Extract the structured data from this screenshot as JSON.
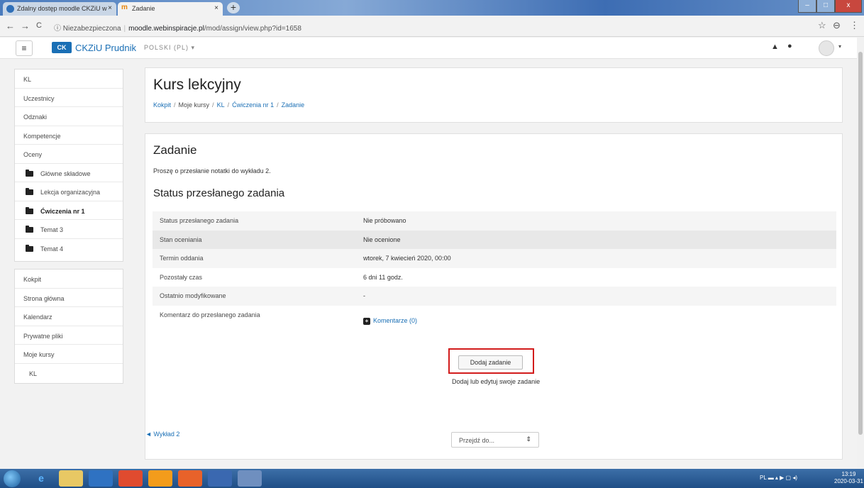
{
  "browser": {
    "tabs": [
      {
        "label": "Zdalny dostęp moodle CKZiU w",
        "close": "×"
      },
      {
        "label": "Zadanie",
        "close": "×"
      }
    ],
    "new_tab": "+",
    "window_controls": {
      "minimize": "–",
      "maximize": "□",
      "close": "x"
    },
    "nav": {
      "back": "←",
      "forward": "→",
      "reload": "C"
    },
    "address": {
      "security": "Niezabezpieczona",
      "host": "moodle.webinspiracje.pl",
      "path": "/mod/assign/view.php?id=1658",
      "info_icon": "ⓘ"
    },
    "star": "☆",
    "profile": "⊖",
    "menu": "⋮"
  },
  "navbar": {
    "menu_glyph": "≡",
    "logo_text": "CK",
    "site_name": "CKZiU Prudnik",
    "language": "POLSKI (PL) ▾",
    "bell": "🔔",
    "messages": "💬",
    "avatar_caret": "▾"
  },
  "sidebar": {
    "course_items": [
      {
        "label": "KL"
      },
      {
        "label": "Uczestnicy"
      },
      {
        "label": "Odznaki"
      },
      {
        "label": "Kompetencje"
      },
      {
        "label": "Oceny"
      },
      {
        "label": "Główne składowe"
      },
      {
        "label": "Lekcja organizacyjna"
      },
      {
        "label": "Ćwiczenia nr 1"
      },
      {
        "label": "Temat 3"
      },
      {
        "label": "Temat 4"
      }
    ],
    "site_items": [
      {
        "label": "Kokpit"
      },
      {
        "label": "Strona główna"
      },
      {
        "label": "Kalendarz"
      },
      {
        "label": "Prywatne pliki"
      },
      {
        "label": "Moje kursy"
      },
      {
        "label": "KL"
      }
    ]
  },
  "header": {
    "title": "Kurs lekcyjny",
    "breadcrumb": {
      "kokpit": "Kokpit",
      "moje_kursy": "Moje kursy",
      "kl": "KL",
      "cwiczenia": "Ćwiczenia nr 1",
      "zadanie": "Zadanie",
      "separator": "/"
    }
  },
  "assignment": {
    "title": "Zadanie",
    "intro": "Proszę o przesłanie notatki do wykładu 2.",
    "status_heading": "Status przesłanego zadania",
    "rows": [
      {
        "label": "Status przesłanego zadania",
        "value": "Nie próbowano"
      },
      {
        "label": "Stan oceniania",
        "value": "Nie ocenione"
      },
      {
        "label": "Termin oddania",
        "value": "wtorek, 7 kwiecień 2020, 00:00"
      },
      {
        "label": "Pozostały czas",
        "value": "6 dni 11 godz."
      },
      {
        "label": "Ostatnio modyfikowane",
        "value": "-"
      },
      {
        "label": "Komentarz do przesłanego zadania",
        "value": ""
      }
    ],
    "comments_link": "Komentarze (0)",
    "comments_plus": "+",
    "add_button": "Dodaj zadanie",
    "add_hint": "Dodaj lub edytuj swoje zadanie",
    "prev_link": "◄ Wykład 2",
    "jump_placeholder": "Przejdź do...",
    "jump_arrow": "⇕"
  },
  "taskbar": {
    "tray": "PL ▬ ▴ ▶ ▢ ◂)",
    "time": "13:19",
    "date": "2020-03-31"
  },
  "colors": {
    "link": "#1a6fb5",
    "highlight": "#d21c1c"
  }
}
